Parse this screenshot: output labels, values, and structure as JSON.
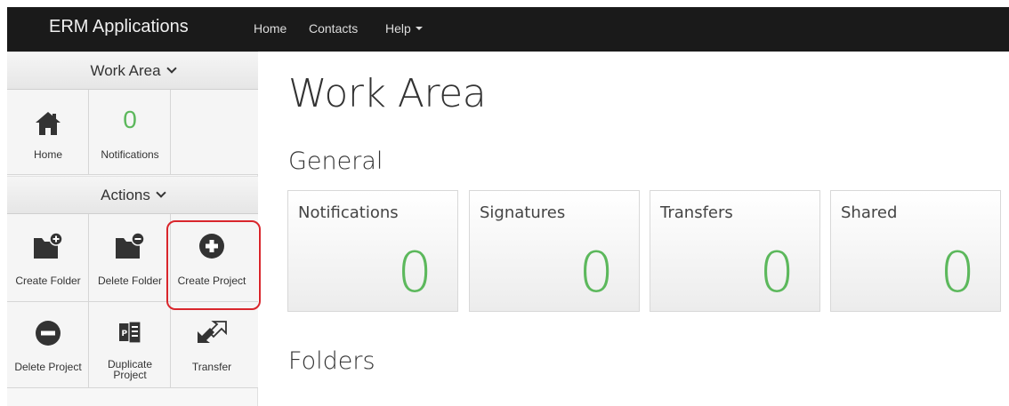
{
  "navbar": {
    "brand": "ERM Applications",
    "links": [
      "Home",
      "Contacts",
      "Help"
    ]
  },
  "sidebar": {
    "work_area_header": "Work Area",
    "work_area_tiles": [
      {
        "label": "Home",
        "icon": "home-icon"
      },
      {
        "label": "Notifications",
        "count": "0"
      }
    ],
    "actions_header": "Actions",
    "action_tiles": [
      {
        "label": "Create Folder",
        "icon": "folder-plus-icon"
      },
      {
        "label": "Delete Folder",
        "icon": "folder-minus-icon"
      },
      {
        "label": "Create Project",
        "icon": "plus-circle-icon"
      },
      {
        "label": "Delete Project",
        "icon": "minus-circle-icon"
      },
      {
        "label_line1": "Duplicate",
        "label_line2": "Project",
        "icon": "duplicate-project-icon"
      },
      {
        "label": "Transfer",
        "icon": "transfer-icon"
      }
    ]
  },
  "main": {
    "title": "Work Area",
    "general_heading": "General",
    "cards": [
      {
        "label": "Notifications",
        "value": "0"
      },
      {
        "label": "Signatures",
        "value": "0"
      },
      {
        "label": "Transfers",
        "value": "0"
      },
      {
        "label": "Shared",
        "value": "0"
      }
    ],
    "folders_heading": "Folders"
  },
  "colors": {
    "navbar_bg": "#1a1a1a",
    "accent_green": "#5cb85c",
    "highlight_red": "#d9262c"
  }
}
